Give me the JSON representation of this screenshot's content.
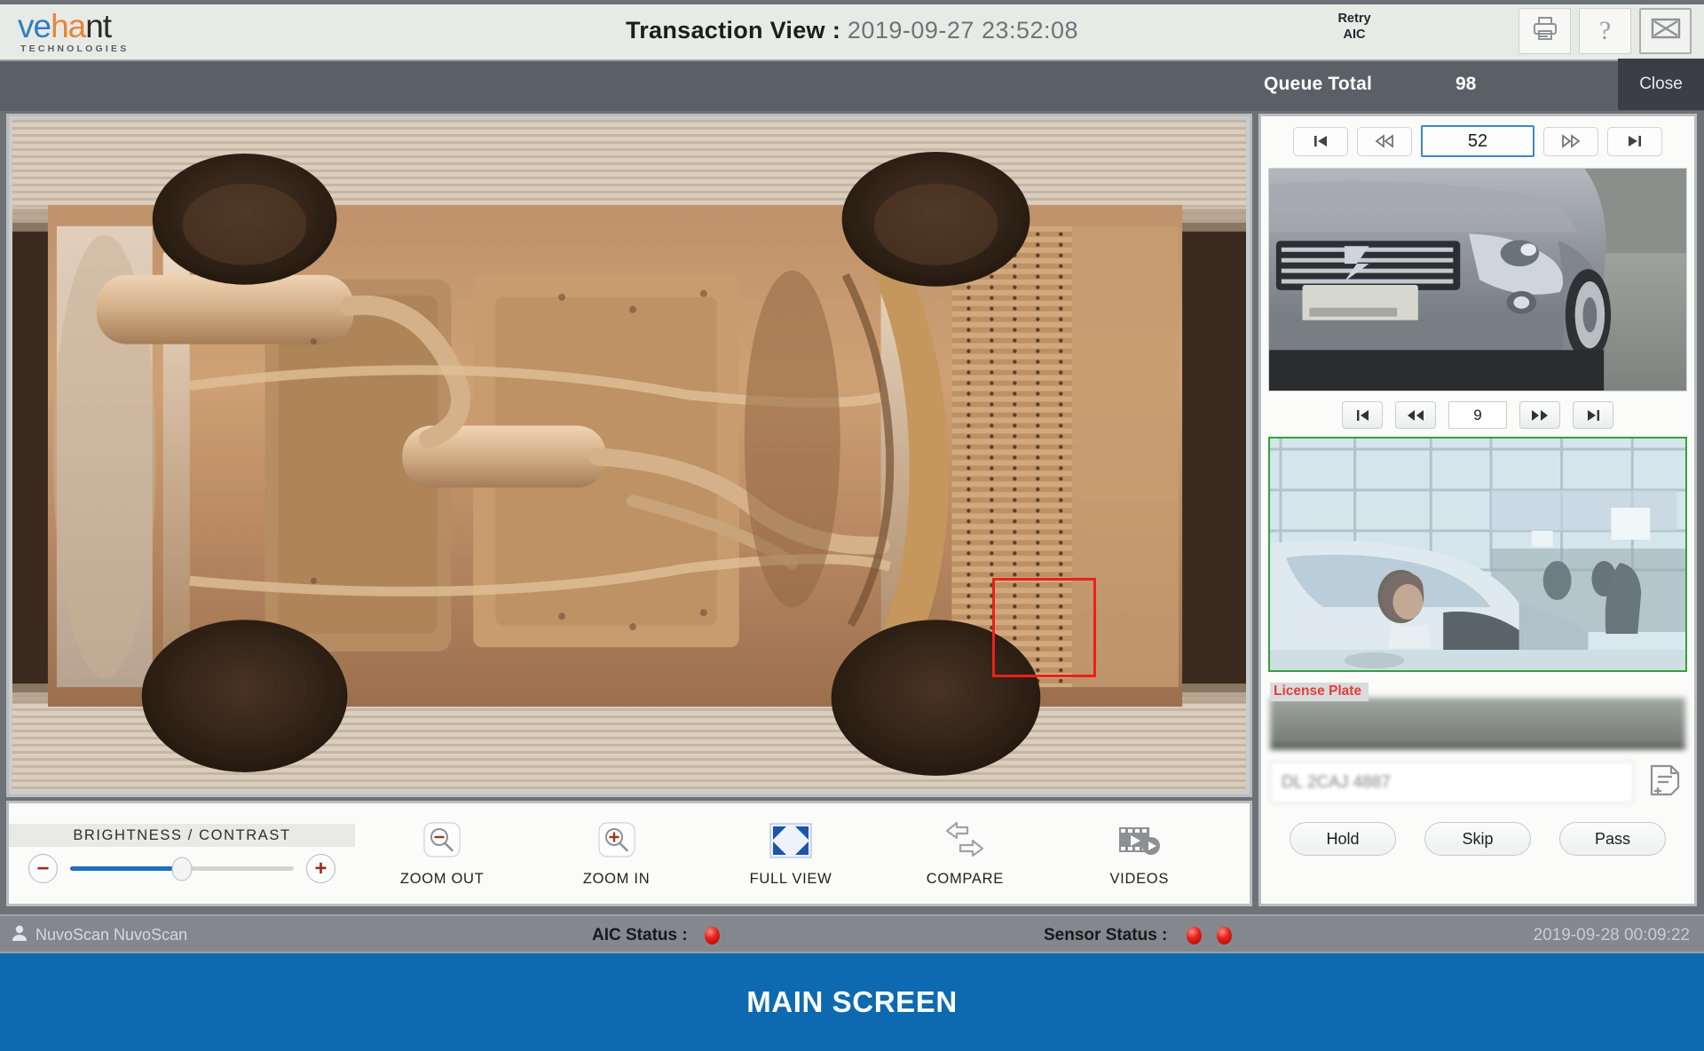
{
  "brand": {
    "logo_part1": "ve",
    "logo_part2": "ha",
    "logo_part3": "nt",
    "tagline": "TECHNOLOGIES"
  },
  "header": {
    "title_label": "Transaction View",
    "separator": ":",
    "timestamp": "2019-09-27 23:52:08",
    "retry_aic": "Retry\nAIC",
    "retry_aic_line1": "Retry",
    "retry_aic_line2": "AIC",
    "icons": [
      "print-icon",
      "help-icon",
      "close-window-icon"
    ]
  },
  "queue": {
    "label": "Queue Total",
    "value": "98",
    "close_label": "Close"
  },
  "image_nav": {
    "first_label": "first-frame",
    "prev_label": "previous-frame",
    "value": "52",
    "next_label": "next-frame",
    "last_label": "last-frame"
  },
  "vehicle_nav": {
    "first_label": "first-image",
    "prev_label": "previous-image",
    "value": "9",
    "next_label": "next-image",
    "last_label": "last-image"
  },
  "license": {
    "label": "License Plate",
    "plate_value": "",
    "input_value": "DL 2CAJ 4887",
    "note_icon": "add-note-icon"
  },
  "actions": {
    "hold": "Hold",
    "skip": "Skip",
    "pass": "Pass"
  },
  "toolbar": {
    "brightness_label": "BRIGHTNESS / CONTRAST",
    "slider_value": "50",
    "decrease_label": "–",
    "increase_label": "+",
    "items": [
      {
        "label": "ZOOM OUT",
        "icon": "zoom-out-icon"
      },
      {
        "label": "ZOOM IN",
        "icon": "zoom-in-icon"
      },
      {
        "label": "FULL VIEW",
        "icon": "full-view-icon"
      },
      {
        "label": "COMPARE",
        "icon": "compare-icon"
      },
      {
        "label": "VIDEOS",
        "icon": "videos-icon"
      }
    ]
  },
  "status": {
    "user": "NuvoScan NuvoScan",
    "aic_label": "AIC Status :",
    "aic_leds": 1,
    "sensor_label": "Sensor Status :",
    "sensor_leds": 2,
    "timestamp": "2019-09-28 00:09:22"
  },
  "footer": {
    "text": "MAIN SCREEN"
  },
  "colors": {
    "accent_blue": "#0d6ab0",
    "detection_red": "#ee1f18",
    "led_red": "#e8211a",
    "driver_border_green": "#34a13a",
    "brand_blue": "#2d7fc1",
    "brand_orange": "#e8833a"
  },
  "detection": {
    "present": true,
    "shape": "rectangle",
    "color": "#ee1f18"
  }
}
